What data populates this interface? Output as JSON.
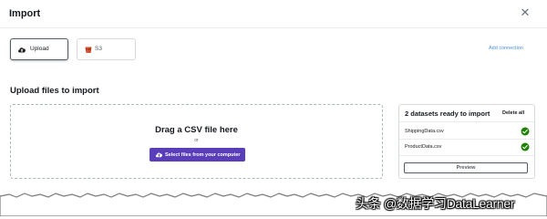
{
  "dialog": {
    "title": "Import",
    "close_icon": "close-icon"
  },
  "sources": {
    "upload_label": "Upload",
    "upload_icon": "cloud-upload-icon",
    "s3_label": "S3",
    "s3_icon": "s3-bucket-icon",
    "add_connection": "Add connection"
  },
  "upload": {
    "heading": "Upload files to import",
    "drag_text": "Drag a CSV file here",
    "or_text": "or",
    "select_button": "Select files from your computer",
    "select_icon": "cloud-upload-icon"
  },
  "datasets": {
    "title": "2 datasets ready to import",
    "delete_all": "Delete all",
    "files": [
      {
        "name": "ShippingData.csv",
        "status": "ready"
      },
      {
        "name": "ProductData.csv",
        "status": "ready"
      }
    ],
    "preview_button": "Preview"
  },
  "watermark": "头条 @数据学习DataLearner",
  "colors": {
    "accent": "#5a3db8",
    "link": "#4a90e2",
    "success": "#1d8102",
    "s3": "#c7511f",
    "border": "#d5dbdb"
  }
}
